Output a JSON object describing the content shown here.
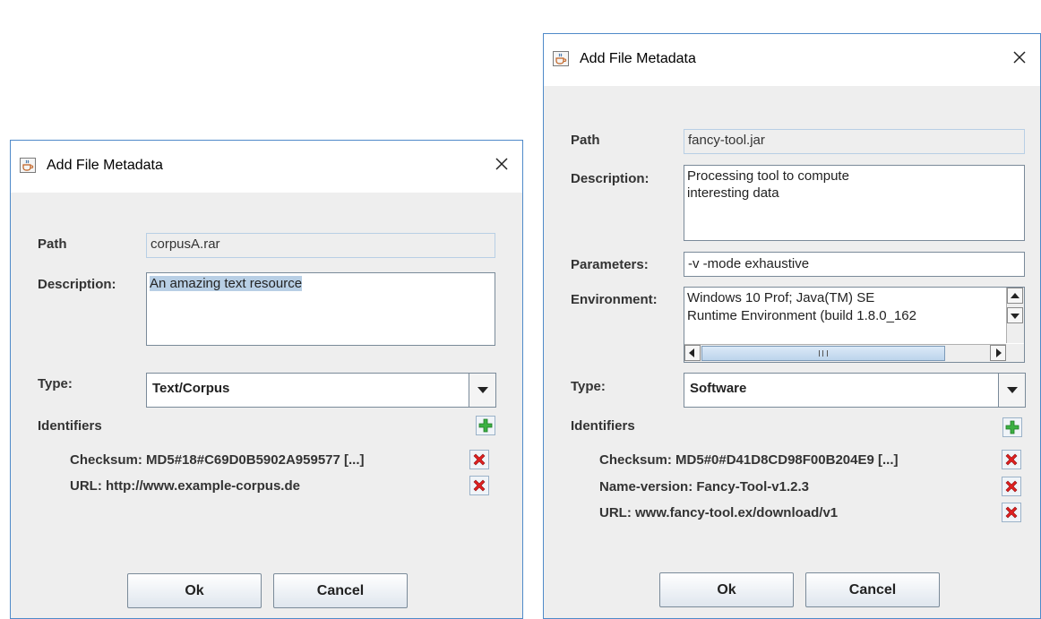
{
  "dialog_left": {
    "title": "Add File Metadata",
    "path_label": "Path",
    "path_value": "corpusA.rar",
    "description_label": "Description:",
    "description_value": "An amazing text resource",
    "type_label": "Type:",
    "type_value": "Text/Corpus",
    "identifiers_label": "Identifiers",
    "identifiers": [
      "Checksum: MD5#18#C69D0B5902A959577 [...]",
      "URL: http://www.example-corpus.de"
    ],
    "ok_label": "Ok",
    "cancel_label": "Cancel"
  },
  "dialog_right": {
    "title": "Add File Metadata",
    "path_label": "Path",
    "path_value": "fancy-tool.jar",
    "description_label": "Description:",
    "description_line1": "Processing tool to compute",
    "description_line2": "interesting data",
    "parameters_label": "Parameters:",
    "parameters_value": "-v  -mode exhaustive",
    "environment_label": "Environment:",
    "environment_line1": "Windows 10 Prof; Java(TM) SE",
    "environment_line2": "Runtime Environment (build 1.8.0_162",
    "type_label": "Type:",
    "type_value": "Software",
    "identifiers_label": "Identifiers",
    "identifiers": [
      "Checksum: MD5#0#D41D8CD98F00B204E9 [...]",
      "Name-version: Fancy-Tool-v1.2.3",
      "URL: www.fancy-tool.ex/download/v1"
    ],
    "ok_label": "Ok",
    "cancel_label": "Cancel"
  },
  "icons": {
    "app": "java-cup-icon",
    "close": "close-icon",
    "add": "green-plus-icon",
    "remove": "red-x-icon"
  },
  "colors": {
    "dialog_bg": "#eeeeee",
    "window_border": "#4f8ac9",
    "add_icon": "#3cb043",
    "remove_icon": "#e02020"
  }
}
